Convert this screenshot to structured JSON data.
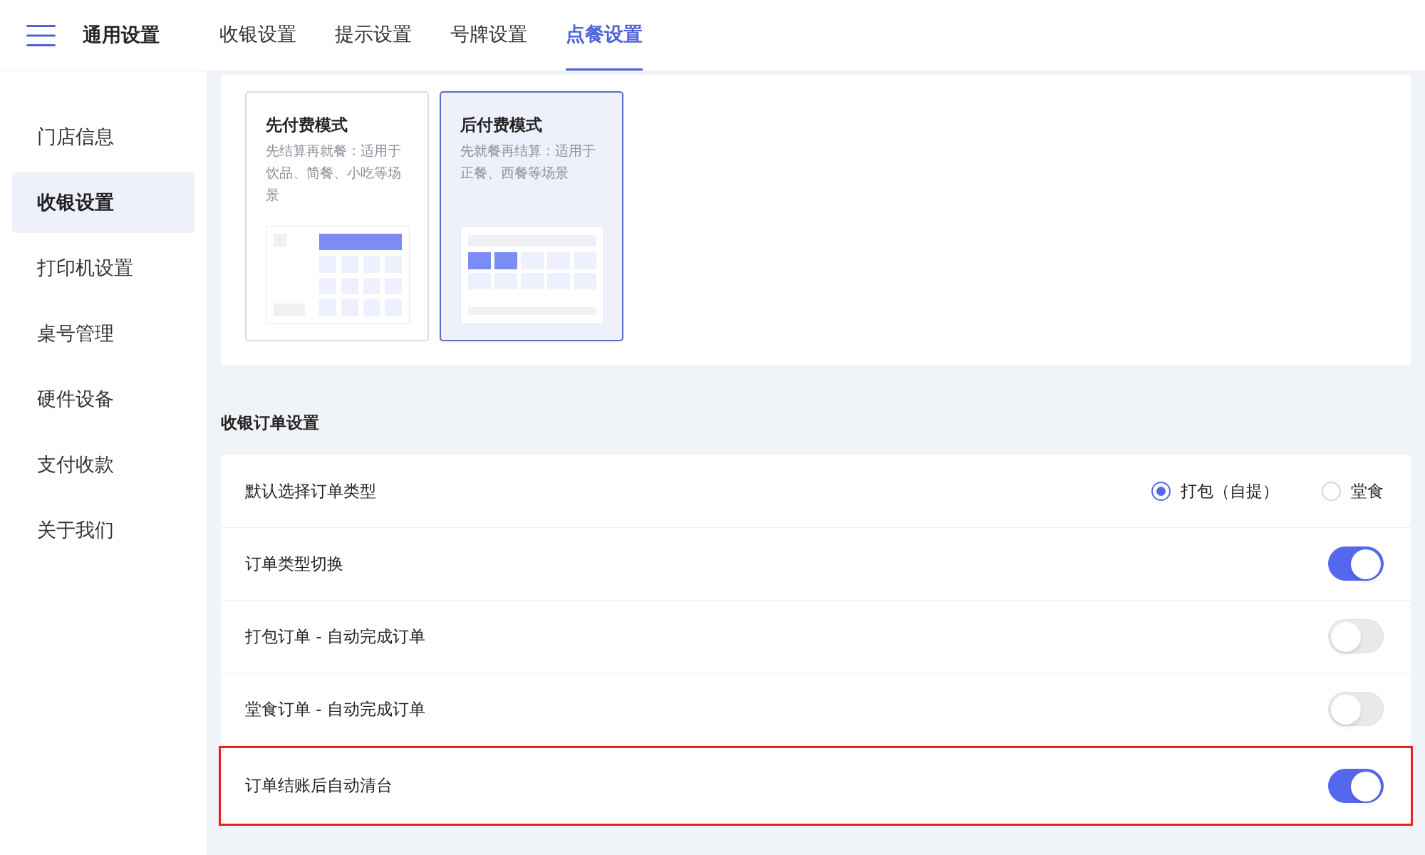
{
  "header": {
    "title": "通用设置",
    "tabs": [
      {
        "label": "收银设置",
        "selected": false
      },
      {
        "label": "提示设置",
        "selected": false
      },
      {
        "label": "号牌设置",
        "selected": false
      },
      {
        "label": "点餐设置",
        "selected": true
      }
    ]
  },
  "sidebar": {
    "items": [
      {
        "label": "门店信息",
        "selected": false
      },
      {
        "label": "收银设置",
        "selected": true
      },
      {
        "label": "打印机设置",
        "selected": false
      },
      {
        "label": "桌号管理",
        "selected": false
      },
      {
        "label": "硬件设备",
        "selected": false
      },
      {
        "label": "支付收款",
        "selected": false
      },
      {
        "label": "关于我们",
        "selected": false
      }
    ]
  },
  "payment_modes": [
    {
      "kind": "prepay",
      "title": "先付费模式",
      "description": "先结算再就餐：适用于饮品、简餐、小吃等场景",
      "selected": false
    },
    {
      "kind": "postpay",
      "title": "后付费模式",
      "description": "先就餐再结算：适用于正餐、西餐等场景",
      "selected": true
    }
  ],
  "order_settings": {
    "title": "收银订单设置",
    "rows": [
      {
        "kind": "radio",
        "label": "默认选择订单类型",
        "highlighted": false,
        "options": [
          {
            "label": "打包（自提）",
            "selected": true
          },
          {
            "label": "堂食",
            "selected": false
          }
        ]
      },
      {
        "kind": "toggle",
        "label": "订单类型切换",
        "on": true,
        "highlighted": false
      },
      {
        "kind": "toggle",
        "label": "打包订单 - 自动完成订单",
        "on": false,
        "highlighted": false
      },
      {
        "kind": "toggle",
        "label": "堂食订单 - 自动完成订单",
        "on": false,
        "highlighted": false
      },
      {
        "kind": "toggle",
        "label": "订单结账后自动清台",
        "on": true,
        "highlighted": true
      }
    ]
  }
}
